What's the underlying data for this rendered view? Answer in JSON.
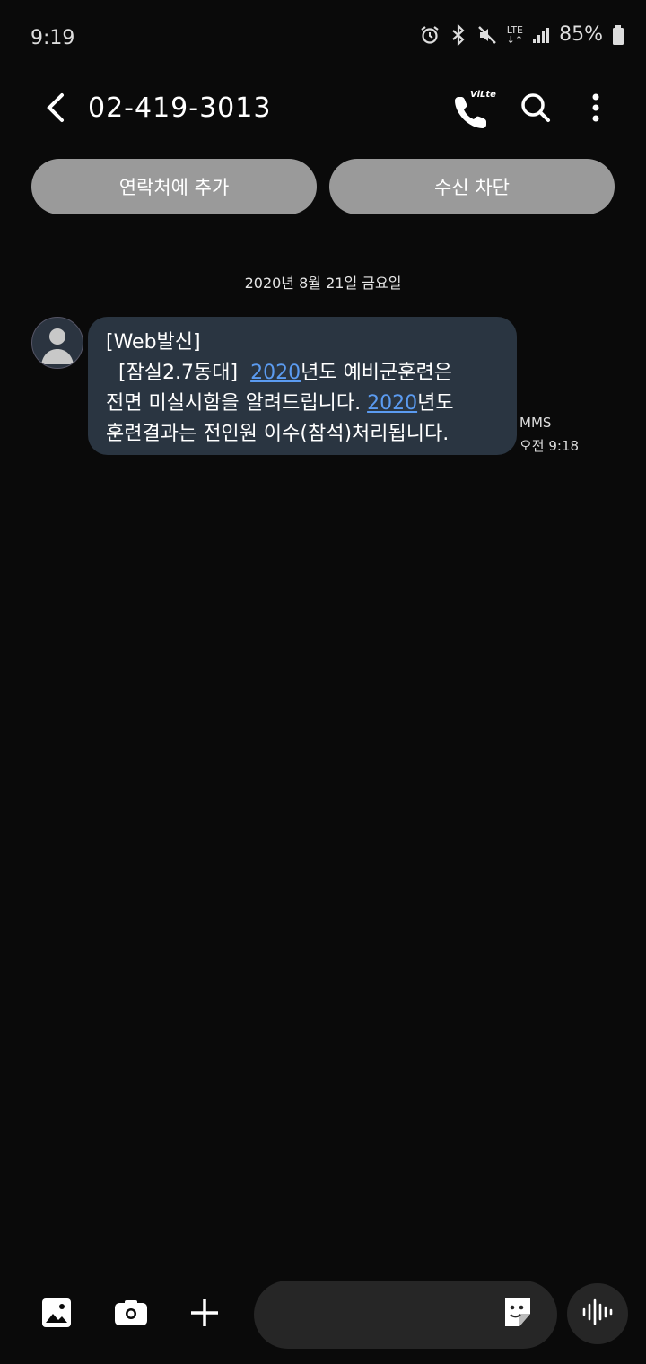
{
  "status_bar": {
    "time": "9:19",
    "battery_text": "85%",
    "network_label": "LTE",
    "icons": [
      "alarm-icon",
      "bluetooth-icon",
      "mute-icon",
      "lte-icon",
      "signal-icon",
      "battery-icon"
    ]
  },
  "header": {
    "title": "02-419-3013",
    "back_icon": "back-arrow-icon",
    "call_icon": "vilte-call-icon",
    "call_badge": "ViLte",
    "search_icon": "search-icon",
    "more_icon": "more-vertical-icon"
  },
  "actions": {
    "add_contact_label": "연락처에 추가",
    "block_label": "수신 차단"
  },
  "conversation": {
    "date_separator": "2020년 8월 21일 금요일",
    "message": {
      "line1": "[Web발신]",
      "line2_prefix": "  [잠실2.7동대]  ",
      "line2_link": "2020",
      "line2_suffix": "년도 예비군훈련은",
      "line3_prefix": "전면 미실시함을 알려드립니다. ",
      "line3_link": "2020",
      "line3_suffix": "년도",
      "line4": "훈련결과는 전인원 이수(참석)처리됩니다.",
      "type": "MMS",
      "time": "오전 9:18"
    }
  },
  "bottom_bar": {
    "icons": [
      "gallery-icon",
      "camera-icon",
      "plus-icon",
      "sticker-icon",
      "voice-record-icon"
    ]
  },
  "colors": {
    "background": "#0a0a0a",
    "bubble": "#2a3541",
    "pill": "#9a9a9a",
    "link": "#5b9bf0",
    "composer": "#262626"
  }
}
